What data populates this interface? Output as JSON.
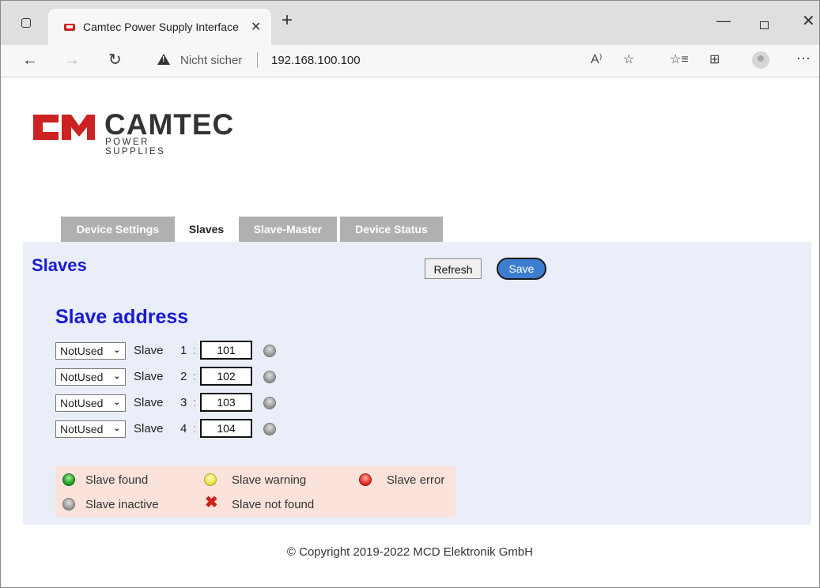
{
  "browser": {
    "tab_title": "Camtec Power Supply Interface",
    "tab_close": "✕",
    "new_tab": "+",
    "security_label": "Nicht sicher",
    "url": "192.168.100.100",
    "icons": [
      "sidebar-toggle-icon",
      "back-icon",
      "forward-icon",
      "reload-icon",
      "warning-icon",
      "read-aloud-icon",
      "favorite-add-icon",
      "favorites-icon",
      "collections-icon",
      "profile-icon",
      "more-icon"
    ]
  },
  "logo": {
    "name": "CAMTEC",
    "subtitle": "POWER SUPPLIES",
    "brand_color": "#cc2222"
  },
  "nav_tabs": [
    {
      "label": "Device Settings",
      "active": false
    },
    {
      "label": "Slaves",
      "active": true
    },
    {
      "label": "Slave-Master",
      "active": false
    },
    {
      "label": "Device Status",
      "active": false
    }
  ],
  "page": {
    "title": "Slaves",
    "refresh_label": "Refresh",
    "save_label": "Save",
    "section_title": "Slave address"
  },
  "slaves": [
    {
      "mode": "NotUsed",
      "label": "Slave",
      "number": "1",
      "colon": ":",
      "address": "101",
      "status": "inactive"
    },
    {
      "mode": "NotUsed",
      "label": "Slave",
      "number": "2",
      "colon": ":",
      "address": "102",
      "status": "inactive"
    },
    {
      "mode": "NotUsed",
      "label": "Slave",
      "number": "3",
      "colon": ":",
      "address": "103",
      "status": "inactive"
    },
    {
      "mode": "NotUsed",
      "label": "Slave",
      "number": "4",
      "colon": ":",
      "address": "104",
      "status": "inactive"
    }
  ],
  "legend": {
    "found": "Slave found",
    "warning": "Slave warning",
    "error": "Slave error",
    "inactive": "Slave inactive",
    "not_found": "Slave not found"
  },
  "colors": {
    "heading": "#1a1ad4",
    "panel_bg": "#eaeef9",
    "legend_bg": "#fbe3dc",
    "save_button": "#3d7dd0"
  },
  "footer": "© Copyright 2019-2022 MCD Elektronik GmbH"
}
